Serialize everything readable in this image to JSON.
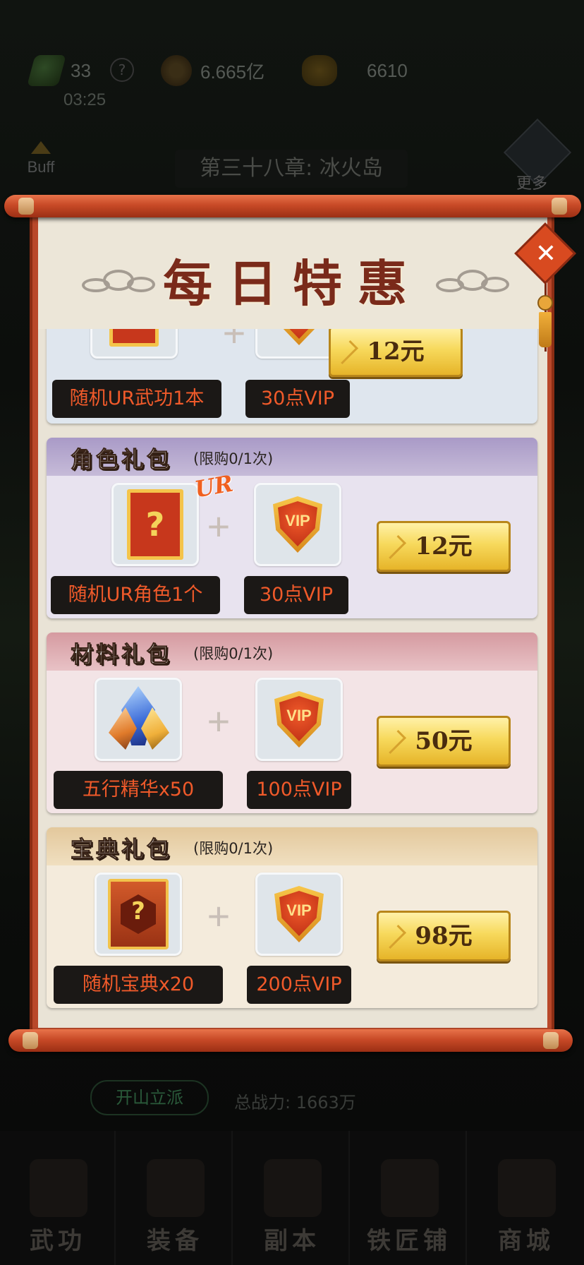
{
  "status": {
    "stamina": "33",
    "copper": "6.665亿",
    "gold": "6610",
    "timer": "03:25",
    "help_glyph": "?"
  },
  "buff_label": "Buff",
  "chapter_title": "第三十八章: 冰火岛",
  "more_label": "更多",
  "dialog": {
    "title": "每日特惠",
    "close_glyph": "✕",
    "packs": [
      {
        "title": "",
        "limit": "",
        "item_label": "随机UR武功1本",
        "vip_label": "30点VIP",
        "price": "12元",
        "header_color": "#b0bccb"
      },
      {
        "title": "角色礼包",
        "limit": "(限购0/1次)",
        "item_label": "随机UR角色1个",
        "vip_label": "30点VIP",
        "price": "12元",
        "ur_badge": "UR",
        "header_color": "#a99ac7"
      },
      {
        "title": "材料礼包",
        "limit": "(限购0/1次)",
        "item_label": "五行精华x50",
        "vip_label": "100点VIP",
        "price": "50元",
        "header_color": "#d59aa0"
      },
      {
        "title": "宝典礼包",
        "limit": "(限购0/1次)",
        "item_label": "随机宝典x20",
        "vip_label": "200点VIP",
        "price": "98元",
        "header_color": "#e3c89c"
      }
    ],
    "vip_text": "VIP",
    "plus_glyph": "+",
    "question_glyph": "?"
  },
  "sect_button": "开山立派",
  "power_label": "总战力: 1663万",
  "nav": [
    "武功",
    "装备",
    "副本",
    "铁匠铺",
    "商城"
  ],
  "colors": {
    "scroll_rod": "#c84a27",
    "paper": "#e9e3d6",
    "price_gold": "#f7d95c",
    "tag_text": "#f05a2a"
  }
}
